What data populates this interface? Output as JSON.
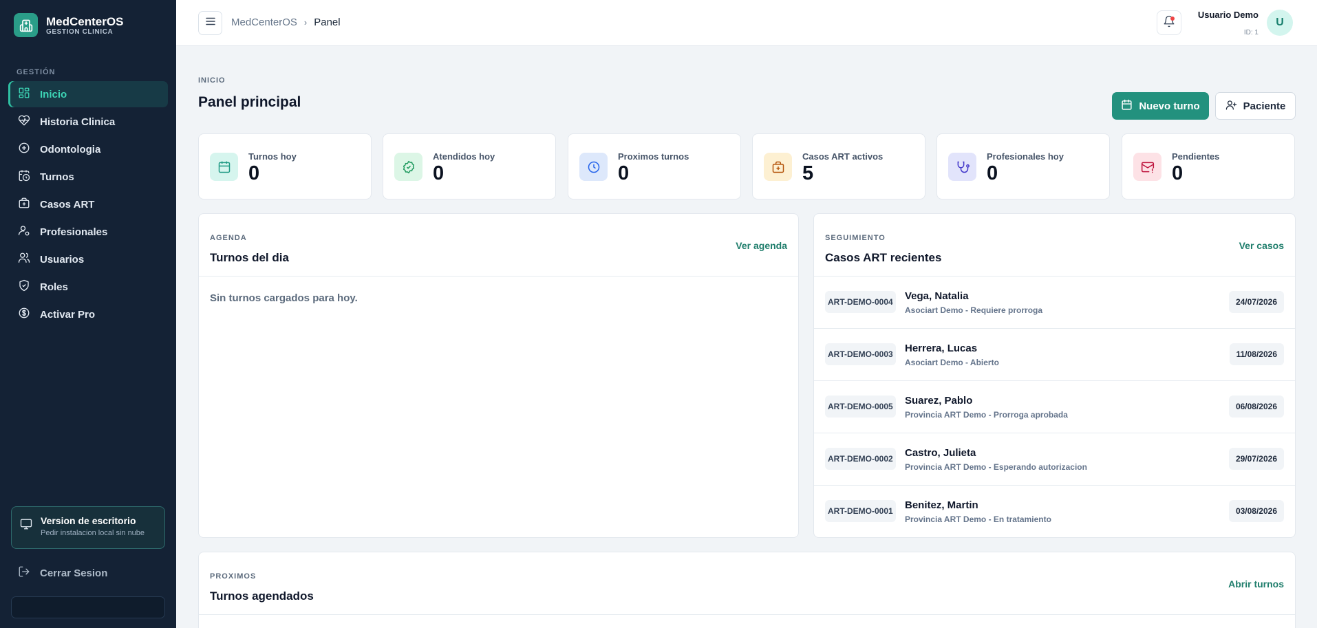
{
  "app": {
    "name": "MedCenterOS",
    "subtitle": "GESTION CLINICA"
  },
  "sidebar": {
    "section_label": "GESTIÓN",
    "items": [
      {
        "label": "Inicio",
        "icon": "grid-icon",
        "active": true
      },
      {
        "label": "Historia Clinica",
        "icon": "heart-pulse-icon"
      },
      {
        "label": "Odontologia",
        "icon": "plus-circle-icon"
      },
      {
        "label": "Turnos",
        "icon": "calendar-clock-icon"
      },
      {
        "label": "Casos ART",
        "icon": "briefcase-medical-icon"
      },
      {
        "label": "Profesionales",
        "icon": "user-cog-icon"
      },
      {
        "label": "Usuarios",
        "icon": "users-icon"
      },
      {
        "label": "Roles",
        "icon": "shield-check-icon"
      },
      {
        "label": "Activar Pro",
        "icon": "dollar-circle-icon"
      }
    ],
    "desktop_card": {
      "title": "Version de escritorio",
      "subtitle": "Pedir instalacion local sin nube"
    },
    "logout_label": "Cerrar Sesion"
  },
  "topbar": {
    "breadcrumb": [
      "MedCenterOS",
      "Panel"
    ],
    "user_name": "Usuario Demo",
    "user_id": "ID: 1",
    "avatar_initial": "U"
  },
  "header": {
    "kicker": "INICIO",
    "title": "Panel principal",
    "primary_button": "Nuevo turno",
    "secondary_button": "Paciente"
  },
  "stats": [
    {
      "label": "Turnos hoy",
      "value": "0",
      "icon": "calendar-icon",
      "color": "#1f9a84",
      "bg": "#d6f5ee"
    },
    {
      "label": "Atendidos hoy",
      "value": "0",
      "icon": "check-badge-icon",
      "color": "#1f9a5e",
      "bg": "#dcf6e6"
    },
    {
      "label": "Proximos turnos",
      "value": "0",
      "icon": "clock-icon",
      "color": "#2563eb",
      "bg": "#dde8fb"
    },
    {
      "label": "Casos ART activos",
      "value": "5",
      "icon": "briefcase-medical-icon",
      "color": "#b45309",
      "bg": "#fdf0d2"
    },
    {
      "label": "Profesionales hoy",
      "value": "0",
      "icon": "stethoscope-icon",
      "color": "#4338ca",
      "bg": "#e2e4fb"
    },
    {
      "label": "Pendientes",
      "value": "0",
      "icon": "mail-alert-icon",
      "color": "#be123c",
      "bg": "#fde2e6"
    }
  ],
  "agenda": {
    "kicker": "AGENDA",
    "title": "Turnos del dia",
    "link": "Ver agenda",
    "empty": "Sin turnos cargados para hoy."
  },
  "cases": {
    "kicker": "SEGUIMIENTO",
    "title": "Casos ART recientes",
    "link": "Ver casos",
    "rows": [
      {
        "code": "ART-DEMO-0004",
        "name": "Vega, Natalia",
        "detail": "Asociart Demo - Requiere prorroga",
        "date": "24/07/2026"
      },
      {
        "code": "ART-DEMO-0003",
        "name": "Herrera, Lucas",
        "detail": "Asociart Demo - Abierto",
        "date": "11/08/2026"
      },
      {
        "code": "ART-DEMO-0005",
        "name": "Suarez, Pablo",
        "detail": "Provincia ART Demo - Prorroga aprobada",
        "date": "06/08/2026"
      },
      {
        "code": "ART-DEMO-0002",
        "name": "Castro, Julieta",
        "detail": "Provincia ART Demo - Esperando autorizacion",
        "date": "29/07/2026"
      },
      {
        "code": "ART-DEMO-0001",
        "name": "Benitez, Martin",
        "detail": "Provincia ART Demo - En tratamiento",
        "date": "03/08/2026"
      }
    ]
  },
  "upcoming": {
    "kicker": "PROXIMOS",
    "title": "Turnos agendados",
    "link": "Abrir turnos"
  }
}
